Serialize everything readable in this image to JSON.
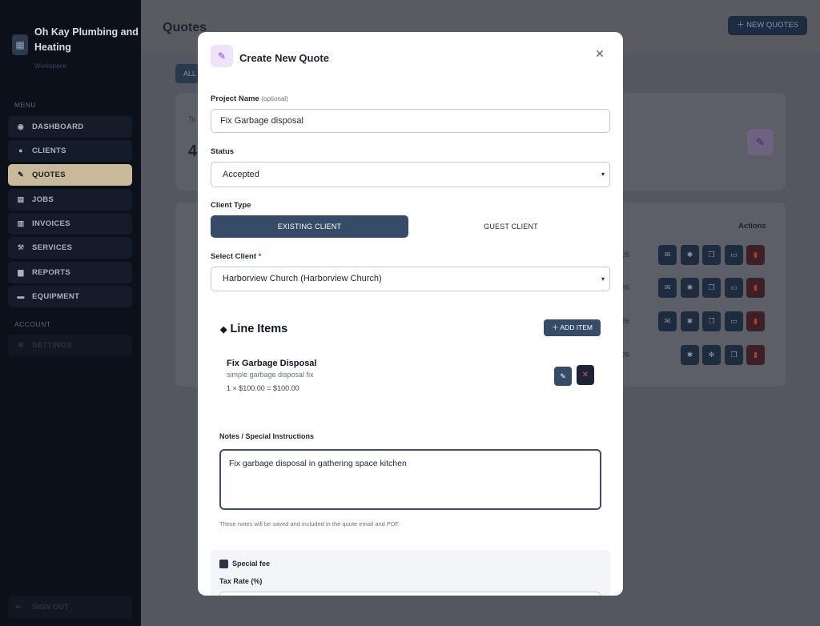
{
  "sidebar": {
    "brand": {
      "name": "Oh Kay Plumbing and Heating",
      "subtitle": "Workspace"
    },
    "menu_label": "MENU",
    "items": [
      {
        "label": "DASHBOARD",
        "icon": "dashboard-icon"
      },
      {
        "label": "CLIENTS",
        "icon": "person-icon"
      },
      {
        "label": "QUOTES",
        "icon": "quote-edit-icon",
        "active": true
      },
      {
        "label": "JOBS",
        "icon": "clipboard-icon"
      },
      {
        "label": "INVOICES",
        "icon": "invoice-icon"
      },
      {
        "label": "SERVICES",
        "icon": "wrench-icon"
      },
      {
        "label": "REPORTS",
        "icon": "chart-icon"
      },
      {
        "label": "EQUIPMENT",
        "icon": "toolbox-icon"
      }
    ],
    "account_label": "ACCOUNT",
    "settings_label": "SETTINGS",
    "signout_label": "SIGN OUT"
  },
  "page": {
    "title": "Quotes",
    "new_button": "NEW QUOTES",
    "all_tab": "ALL",
    "stat_label": "To",
    "stat_value": "4",
    "actions_header": "Actions",
    "row_dates": [
      "26",
      "26",
      "26",
      "26"
    ]
  },
  "modal": {
    "title": "Create New Quote",
    "project_name": {
      "label": "Project Name",
      "optional": "(optional)",
      "value": "Fix Garbage disposal"
    },
    "status": {
      "label": "Status",
      "value": "Accepted"
    },
    "client_type": {
      "label": "Client Type",
      "existing": "EXISTING CLIENT",
      "guest": "GUEST CLIENT",
      "selected": "existing"
    },
    "select_client": {
      "label": "Select Client",
      "required_mark": "*",
      "value": "Harborview Church (Harborview Church)"
    },
    "line_items": {
      "title": "Line Items",
      "add_button": "ADD ITEM",
      "items": [
        {
          "name": "Fix Garbage Disposal",
          "description": "simple garbage disposal fix",
          "total": "1 × $100.00 = $100.00"
        }
      ]
    },
    "notes": {
      "label": "Notes / Special Instructions",
      "value": "Fix garbage disposal in gathering space kitchen",
      "help": "These notes will be saved and included in the quote email and PDF."
    },
    "special_fee": {
      "label": "Special fee",
      "checked": true
    },
    "tax_rate": {
      "label": "Tax Rate (%)"
    }
  },
  "colors": {
    "accent": "#364b67",
    "sidebar_active": "#c8b99a",
    "danger": "#dc2626"
  }
}
